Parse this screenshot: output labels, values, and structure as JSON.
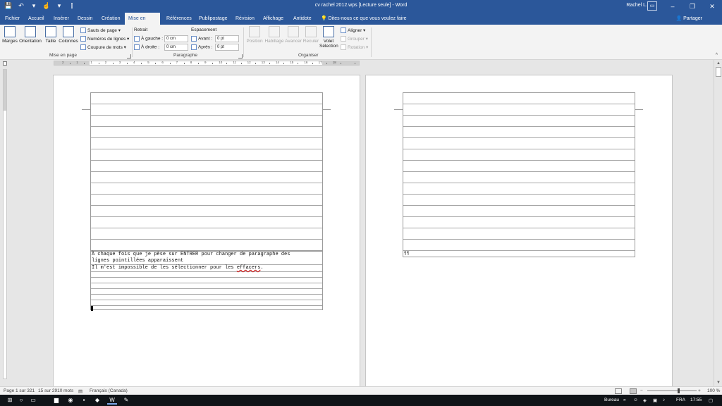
{
  "window": {
    "title": "cv rachel 2012.wps [Lecture seule] - Word",
    "user": "Rachel L.",
    "ribbon_options_icon": "ribbon-display-options-icon",
    "minimize": "–",
    "maximize": "❐",
    "close": "✕"
  },
  "qat": {
    "save": "💾",
    "undo": "↶",
    "undo_drop": "▾",
    "touch": "☝",
    "touch_drop": "▾",
    "customize": "⫿"
  },
  "tabs": [
    "Fichier",
    "Accueil",
    "Insérer",
    "Dessin",
    "Création",
    "Mise en page",
    "Références",
    "Publipostage",
    "Révision",
    "Affichage",
    "Antidote"
  ],
  "active_tab": "Mise en page",
  "tell_me": "Dites-nous ce que vous voulez faire",
  "share": "Partager",
  "ribbon": {
    "mise_en_page": {
      "marges": "Marges",
      "orientation": "Orientation",
      "taille": "Taille",
      "colonnes": "Colonnes",
      "sauts_de_page": "Sauts de page",
      "numeros_de_lignes": "Numéros de lignes",
      "coupure_de_mots": "Coupure de mots",
      "group_label": "Mise en page"
    },
    "paragraphe": {
      "retrait": "Retrait",
      "a_gauche": "À gauche :",
      "a_gauche_value": "0 cm",
      "a_droite": "À droite :",
      "a_droite_value": "0 cm",
      "espacement": "Espacement",
      "avant": "Avant :",
      "avant_value": "0 pt",
      "apres": "Après :",
      "apres_value": "0 pt",
      "group_label": "Paragraphe"
    },
    "organiser": {
      "position": "Position",
      "habillage": "Habillage",
      "avancer": "Avancer",
      "reculer": "Reculer",
      "volet_line1": "Volet",
      "volet_line2": "Sélection",
      "aligner": "Aligner",
      "grouper": "Grouper",
      "rotation": "Rotation",
      "group_label": "Organiser"
    }
  },
  "ruler_numbers": [
    "2",
    "1",
    "1",
    "2",
    "3",
    "4",
    "5",
    "6",
    "7",
    "8",
    "9",
    "10",
    "11",
    "12",
    "13",
    "14",
    "15",
    "16",
    "17",
    "18"
  ],
  "document": {
    "page1_lines": [
      "À chaque fois que je pèse sur ENTRER pour changer de paragraphe des",
      "lignes pointillées apparaissent",
      "Il m'est impossible de les sélectionner pour les "
    ],
    "page1_error_word": "effacers",
    "page1_line3_end": ".",
    "page2_mark": "¶¶"
  },
  "statusbar": {
    "page": "Page 1 sur 321",
    "words": "15 sur 2910 mots",
    "language": "Français (Canada)",
    "zoom": "100 %"
  },
  "taskbar": {
    "desktop": "Bureau",
    "lang": "FRA",
    "time": "17:55"
  }
}
